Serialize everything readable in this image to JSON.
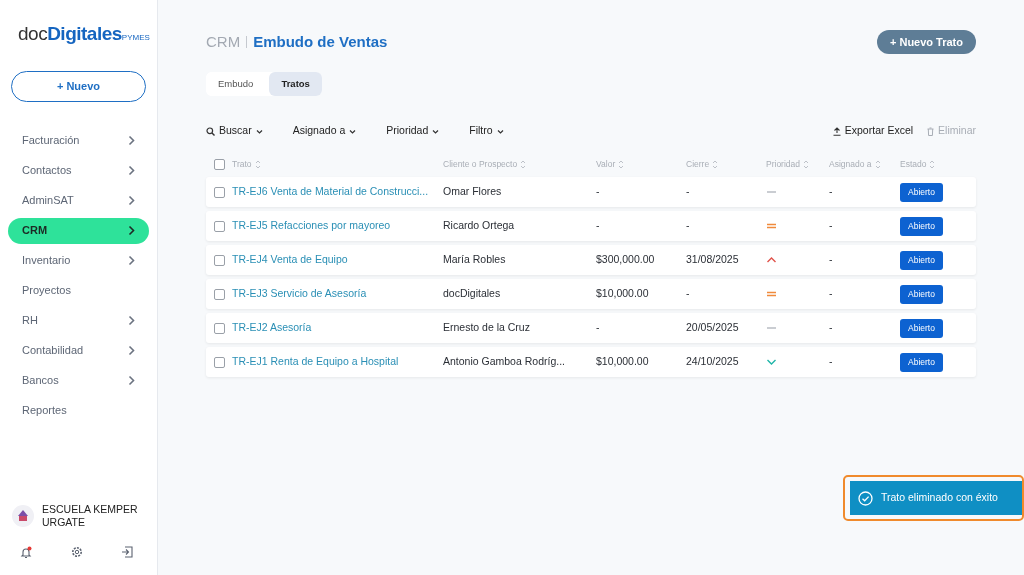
{
  "logo": {
    "prefix": "doc",
    "main": "Digitales",
    "suffix": "PYMES"
  },
  "new_button": {
    "label": "+ Nuevo"
  },
  "sidebar": {
    "items": [
      {
        "label": "Facturación",
        "has_submenu": true,
        "selected": false
      },
      {
        "label": "Contactos",
        "has_submenu": true,
        "selected": false
      },
      {
        "label": "AdminSAT",
        "has_submenu": true,
        "selected": false
      },
      {
        "label": "CRM",
        "has_submenu": true,
        "selected": true
      },
      {
        "label": "Inventario",
        "has_submenu": true,
        "selected": false
      },
      {
        "label": "Proyectos",
        "has_submenu": false,
        "selected": false
      },
      {
        "label": "RH",
        "has_submenu": true,
        "selected": false
      },
      {
        "label": "Contabilidad",
        "has_submenu": true,
        "selected": false
      },
      {
        "label": "Bancos",
        "has_submenu": true,
        "selected": false
      },
      {
        "label": "Reportes",
        "has_submenu": false,
        "selected": false
      }
    ],
    "account": {
      "name": "ESCUELA KEMPER URGATE"
    },
    "notifications_unread": true
  },
  "header": {
    "section": "CRM",
    "title": "Embudo de Ventas",
    "action": "+ Nuevo Trato"
  },
  "tabs": [
    {
      "label": "Embudo",
      "selected": false
    },
    {
      "label": "Tratos",
      "selected": true
    }
  ],
  "filters": [
    {
      "label": "Buscar",
      "kind": "search"
    },
    {
      "label": "Asignado a",
      "kind": "dropdown"
    },
    {
      "label": "Prioridad",
      "kind": "dropdown"
    },
    {
      "label": "Filtro",
      "kind": "dropdown"
    }
  ],
  "actions": [
    {
      "label": "Exportar Excel",
      "kind": "export",
      "disabled": false
    },
    {
      "label": "Eliminar",
      "kind": "delete",
      "disabled": true
    }
  ],
  "table": {
    "select_all_checked": false,
    "columns": [
      "Trato",
      "Cliente o Prospecto",
      "Valor",
      "Cierre",
      "Prioridad",
      "Asignado a",
      "Estado"
    ],
    "rows": [
      {
        "checked": false,
        "deal": "TR-EJ6 Venta de Material de Construcci...",
        "client": "Omar Flores",
        "value": "-",
        "close": "-",
        "priority": {
          "kind": "none"
        },
        "assigned": "-",
        "status": "Abierto"
      },
      {
        "checked": false,
        "deal": "TR-EJ5 Refacciones por mayoreo",
        "client": "Ricardo Ortega",
        "value": "-",
        "close": "-",
        "priority": {
          "kind": "medium"
        },
        "assigned": "-",
        "status": "Abierto"
      },
      {
        "checked": false,
        "deal": "TR-EJ4 Venta de Equipo",
        "client": "María Robles",
        "value": "$300,000.00",
        "close": "31/08/2025",
        "priority": {
          "kind": "high"
        },
        "assigned": "-",
        "status": "Abierto"
      },
      {
        "checked": false,
        "deal": "TR-EJ3 Servicio de Asesoría",
        "client": "docDigitales",
        "value": "$10,000.00",
        "close": "-",
        "priority": {
          "kind": "medium"
        },
        "assigned": "-",
        "status": "Abierto"
      },
      {
        "checked": false,
        "deal": "TR-EJ2 Asesoría",
        "client": "Ernesto de la Cruz",
        "value": "-",
        "close": "20/05/2025",
        "priority": {
          "kind": "none"
        },
        "assigned": "-",
        "status": "Abierto"
      },
      {
        "checked": false,
        "deal": "TR-EJ1 Renta de Equipo a Hospital",
        "client": "Antonio Gamboa Rodríg...",
        "value": "$10,000.00",
        "close": "24/10/2025",
        "priority": {
          "kind": "low"
        },
        "assigned": "-",
        "status": "Abierto"
      }
    ]
  },
  "toast": {
    "message": "Trato eliminado con éxito",
    "highlighted": true
  }
}
